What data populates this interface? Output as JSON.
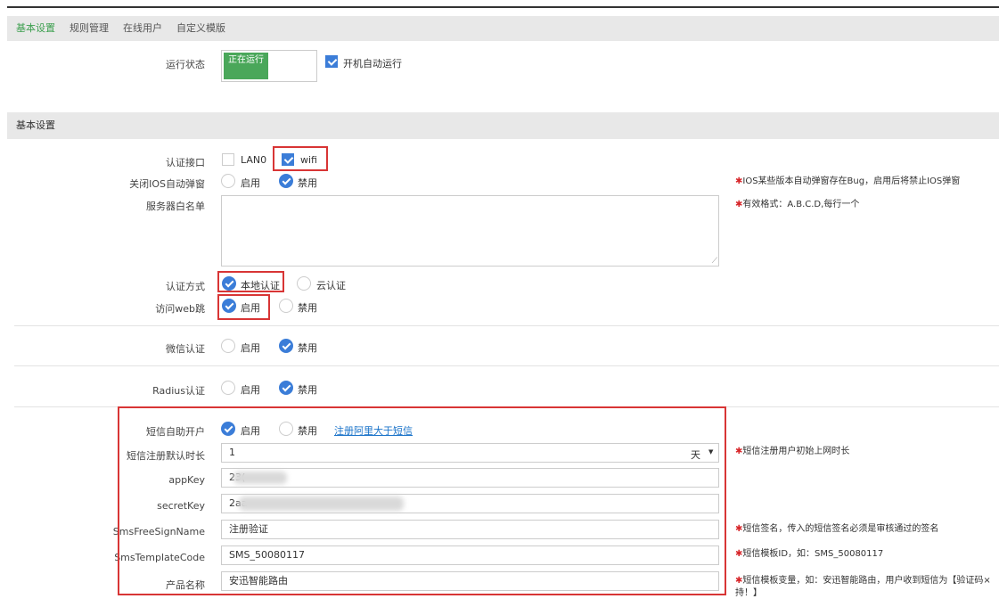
{
  "tabs": [
    "基本设置",
    "规则管理",
    "在线用户",
    "自定义模版"
  ],
  "run_status": {
    "label": "运行状态",
    "toggle_text": "正在运行",
    "autostart_label": "开机自动运行",
    "autostart_checked": true
  },
  "section_title": "基本设置",
  "auth_interface": {
    "label": "认证接口",
    "options": [
      {
        "label": "LAN0",
        "checked": false
      },
      {
        "label": "wifi",
        "checked": true
      }
    ]
  },
  "ios_popup": {
    "label": "关闭IOS自动弹窗",
    "options": [
      "启用",
      "禁用"
    ],
    "selected": "禁用",
    "hint": "IOS某些版本自动弹窗存在Bug，启用后将禁止IOS弹窗"
  },
  "whitelist": {
    "label": "服务器白名单",
    "value": "",
    "hint": "有效格式：A.B.C.D,每行一个"
  },
  "auth_method": {
    "label": "认证方式",
    "options": [
      "本地认证",
      "云认证"
    ],
    "selected": "本地认证"
  },
  "web_redirect": {
    "label": "访问web跳",
    "options": [
      "启用",
      "禁用"
    ],
    "selected": "启用"
  },
  "wechat_auth": {
    "label": "微信认证",
    "options": [
      "启用",
      "禁用"
    ],
    "selected": "禁用"
  },
  "radius_auth": {
    "label": "Radius认证",
    "options": [
      "启用",
      "禁用"
    ],
    "selected": "禁用"
  },
  "sms_signup": {
    "label": "短信自助开户",
    "options": [
      "启用",
      "禁用"
    ],
    "selected": "启用",
    "link": "注册阿里大于短信"
  },
  "sms_duration": {
    "label": "短信注册默认时长",
    "value": "1",
    "unit": "天",
    "hint": "短信注册用户初始上网时长"
  },
  "app_key": {
    "label": "appKey",
    "value": "23("
  },
  "secret_key": {
    "label": "secretKey",
    "value": "2aa"
  },
  "sign_name": {
    "label": "SmsFreeSignName",
    "value": "注册验证",
    "hint": "短信签名，传入的短信签名必须是审核通过的签名"
  },
  "template_code": {
    "label": "SmsTemplateCode",
    "value": "SMS_50080117",
    "hint": "短信模板ID，如：SMS_50080117"
  },
  "product_name": {
    "label": "产品名称",
    "value": "安迅智能路由",
    "hint_line1": "短信模板变量，如：安迅智能路由，用户收到短信为【验证码×",
    "hint_line2": "持！】"
  },
  "colors": {
    "accent_green": "#4aa75a",
    "checked_blue": "#3b7dd8",
    "highlight_red": "#d83535",
    "hint_star": "#d7262a",
    "link_blue": "#1a73c9"
  }
}
